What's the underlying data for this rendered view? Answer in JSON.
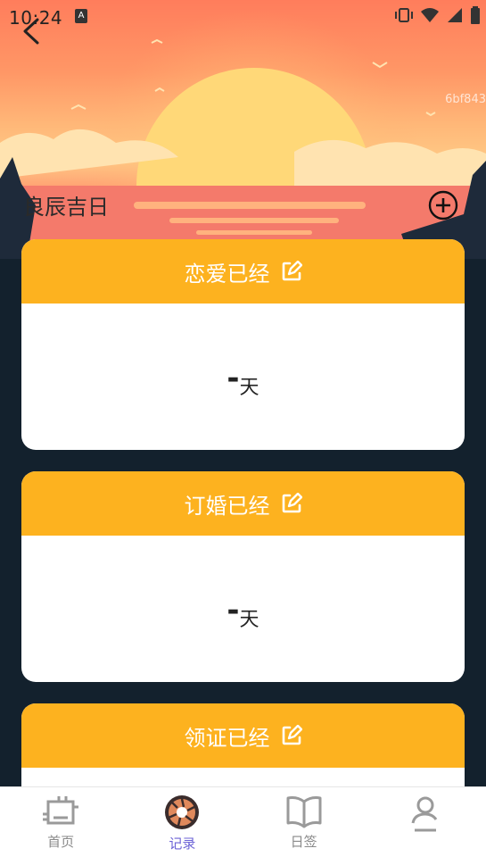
{
  "status_bar": {
    "time": "10:24",
    "notif_icon": "A"
  },
  "header": {
    "watermark": "6bf843",
    "title": "良辰吉日"
  },
  "cards": [
    {
      "title": "恋爱已经",
      "value": "-",
      "unit": "天"
    },
    {
      "title": "订婚已经",
      "value": "-",
      "unit": "天"
    },
    {
      "title": "领证已经",
      "value": "",
      "unit": ""
    }
  ],
  "tabs": [
    {
      "label": "首页",
      "icon": "home-icon"
    },
    {
      "label": "记录",
      "icon": "record-icon"
    },
    {
      "label": "日签",
      "icon": "book-icon"
    },
    {
      "label": "",
      "icon": "profile-icon"
    }
  ],
  "colors": {
    "accent": "#fdb21f",
    "active_tab": "#6c63d6",
    "dark_bg": "#13212d"
  }
}
